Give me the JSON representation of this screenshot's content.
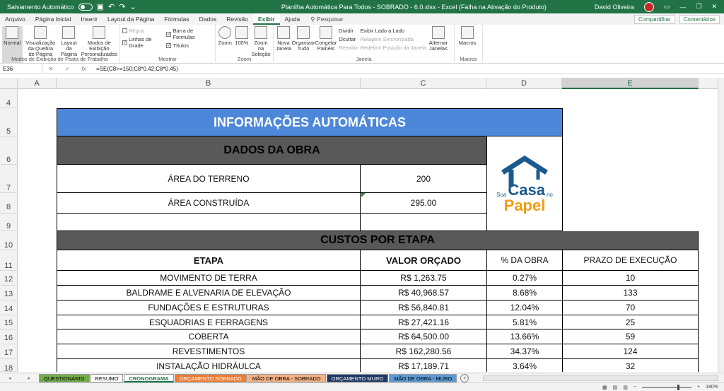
{
  "titlebar": {
    "autosave": "Salvamento Automático",
    "doc_title": "Planilha Automática Para Todos - SOBRADO - 6.0.xlsx  -  Excel (Falha na Ativação do Produto)",
    "user": "David Oliveira",
    "minimize": "—",
    "restore": "❐",
    "close": "✕"
  },
  "menu": {
    "tabs": [
      "Arquivo",
      "Página Inicial",
      "Inserir",
      "Layout da Página",
      "Fórmulas",
      "Dados",
      "Revisão",
      "Exibir",
      "Ajuda"
    ],
    "active": "Exibir",
    "search": "Pesquisar",
    "share": "Compartilhar",
    "comments": "Comentários"
  },
  "ribbon": {
    "workbook_views": {
      "label": "Modos de Exibição de Pasta de Trabalho",
      "normal": "Normal",
      "page_break": "Visualização da Quebra de Página",
      "page_layout": "Layout da Página",
      "custom": "Modos de Exibição Personalizados"
    },
    "show": {
      "label": "Mostrar",
      "ruler": "Régua",
      "formula_bar": "Barra de Fórmulas",
      "gridlines": "Linhas de Grade",
      "headings": "Títulos"
    },
    "zoom": {
      "label": "Zoom",
      "zoom": "Zoom",
      "hundred": "100%",
      "selection": "Zoom na Seleção"
    },
    "window": {
      "label": "Janela",
      "new": "Nova Janela",
      "arrange": "Organizar Tudo",
      "freeze": "Congelar Painéis",
      "split": "Dividir",
      "hide": "Ocultar",
      "unhide": "Reexibir",
      "side_by_side": "Exibir Lado a Lado",
      "sync_scroll": "Rolagem Sincronizada",
      "reset_pos": "Redefinir Posição da Janela",
      "switch": "Alternar Janelas"
    },
    "macros": {
      "label": "Macros",
      "macros": "Macros"
    }
  },
  "formula_bar": {
    "name_box": "E36",
    "formula": "=SE(C8>=150;C8*0.42;C8*0.45)"
  },
  "columns": [
    "A",
    "B",
    "C",
    "D",
    "E"
  ],
  "selected_column": "E",
  "rows": [
    "4",
    "5",
    "6",
    "7",
    "8",
    "9",
    "10",
    "11",
    "12",
    "13",
    "14",
    "15",
    "16",
    "17",
    "18"
  ],
  "sheet": {
    "title": "INFORMAÇÕES AUTOMÁTICAS",
    "dados_header": "DADOS DA OBRA",
    "area_terreno_label": "ÁREA DO TERRENO",
    "area_terreno_value": "200",
    "area_construida_label": "ÁREA CONSTRUÍDA",
    "area_construida_value": "295.00",
    "custos_header": "CUSTOS POR ETAPA",
    "headers": {
      "etapa": "ETAPA",
      "valor": "VALOR ORÇADO",
      "percent": "% DA OBRA",
      "prazo": "PRAZO DE EXECUÇÃO"
    },
    "etapas": [
      {
        "etapa": "MOVIMENTO DE TERRA",
        "valor": "R$ 1,263.75",
        "percent": "0.27%",
        "prazo": "10"
      },
      {
        "etapa": "BALDRAME E ALVENARIA DE ELEVAÇÃO",
        "valor": "R$ 40,968.57",
        "percent": "8.68%",
        "prazo": "133"
      },
      {
        "etapa": "FUNDAÇÕES E ESTRUTURAS",
        "valor": "R$ 56,840.81",
        "percent": "12.04%",
        "prazo": "70"
      },
      {
        "etapa": "ESQUADRIAS E FERRAGENS",
        "valor": "R$ 27,421.16",
        "percent": "5.81%",
        "prazo": "25"
      },
      {
        "etapa": "COBERTA",
        "valor": "R$ 64,500.00",
        "percent": "13.66%",
        "prazo": "59"
      },
      {
        "etapa": "REVESTIMENTOS",
        "valor": "R$ 162,280.56",
        "percent": "34.37%",
        "prazo": "124"
      },
      {
        "etapa": "INSTALAÇÃO HIDRÁULCA",
        "valor": "R$ 17,189.71",
        "percent": "3.64%",
        "prazo": "32"
      }
    ],
    "logo": {
      "sua": "Sua",
      "casa": "Casa",
      "no": "no",
      "papel": "Papel"
    }
  },
  "sheet_tabs": [
    {
      "label": "QUESTIONÁRIO",
      "color": "#70ad47"
    },
    {
      "label": "RESUMO",
      "color": "#ffffff"
    },
    {
      "label": "CRONOGRAMA",
      "color": "#ffffff"
    },
    {
      "label": "ORÇAMENTO SOBRADO",
      "color": "#ed7d31"
    },
    {
      "label": "MÃO DE OBRA - SOBRADO",
      "color": "#f4b183"
    },
    {
      "label": "ORÇAMENTO MURO",
      "color": "#1f3864"
    },
    {
      "label": "MÃO DE OBRA - MURO",
      "color": "#5b9bd5"
    }
  ],
  "active_tab": "CRONOGRAMA",
  "status": {
    "zoom": "180%"
  },
  "colors": {
    "excel_green": "#217346",
    "title_blue": "#4d87d9",
    "header_gray": "#595959",
    "logo_blue": "#1b5a8e",
    "logo_orange": "#f39c12"
  }
}
